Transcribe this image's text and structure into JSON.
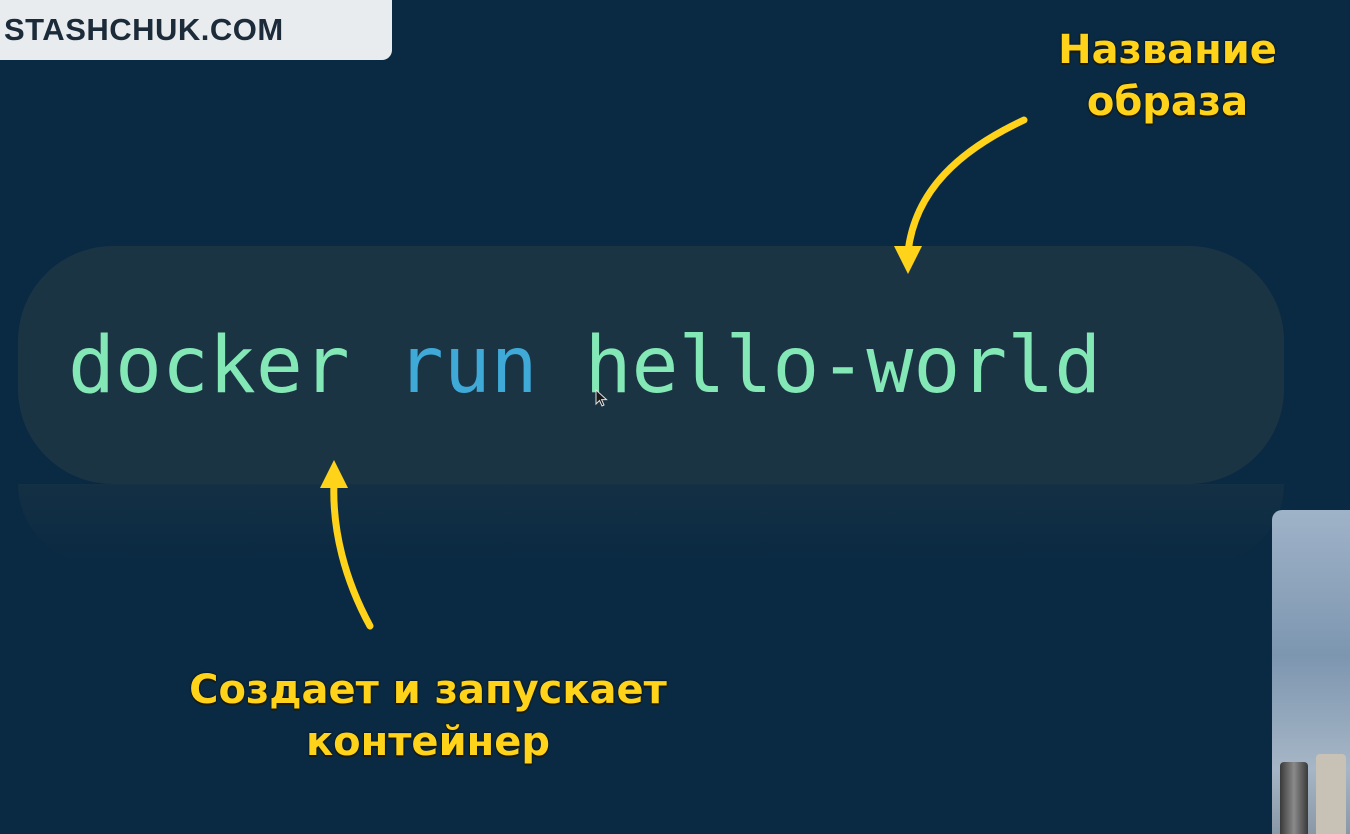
{
  "logo": {
    "text": "STASHCHUK.COM"
  },
  "command": {
    "program": "docker",
    "subcommand": "run",
    "image": "hello-world"
  },
  "annotations": {
    "image_name_line1": "Название",
    "image_name_line2": "образа",
    "run_line1": "Создает и запускает",
    "run_line2": "контейнер"
  },
  "colors": {
    "background": "#0a2a43",
    "command_green": "#83e8b6",
    "command_blue": "#3fa9d8",
    "annotation_yellow": "#ffd31a"
  },
  "icons": [
    "arrow-down-icon",
    "arrow-up-icon",
    "mouse-cursor-icon"
  ]
}
